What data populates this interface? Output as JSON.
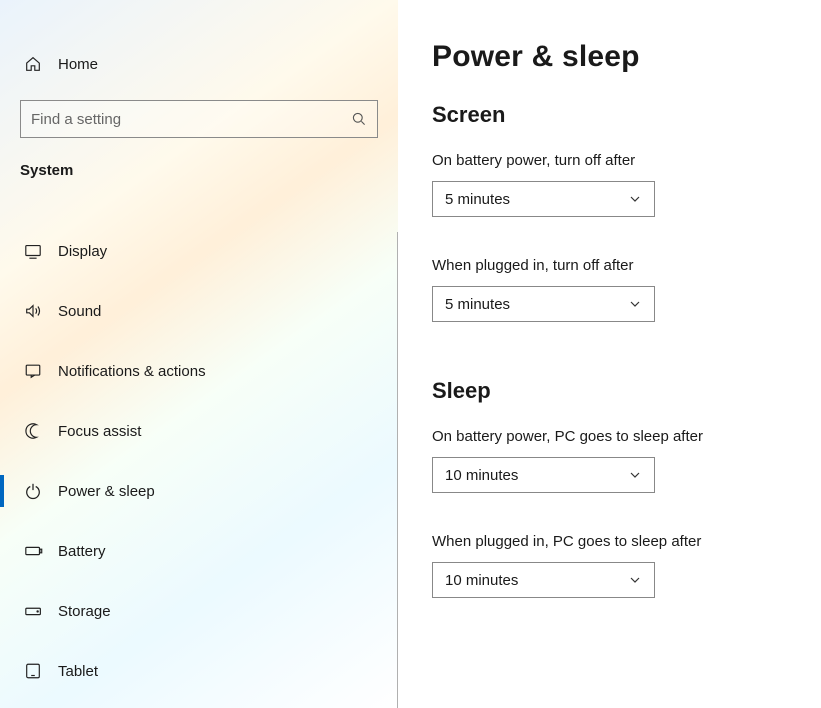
{
  "sidebar": {
    "home_label": "Home",
    "search_placeholder": "Find a setting",
    "category_label": "System",
    "items": [
      {
        "label": "Display",
        "icon": "display-icon"
      },
      {
        "label": "Sound",
        "icon": "sound-icon"
      },
      {
        "label": "Notifications & actions",
        "icon": "notifications-icon"
      },
      {
        "label": "Focus assist",
        "icon": "focus-icon"
      },
      {
        "label": "Power & sleep",
        "icon": "power-icon",
        "active": true
      },
      {
        "label": "Battery",
        "icon": "battery-icon"
      },
      {
        "label": "Storage",
        "icon": "storage-icon"
      },
      {
        "label": "Tablet",
        "icon": "tablet-icon"
      }
    ]
  },
  "main": {
    "title": "Power & sleep",
    "sections": {
      "screen": {
        "title": "Screen",
        "battery_label": "On battery power, turn off after",
        "battery_value": "5 minutes",
        "plugged_label": "When plugged in, turn off after",
        "plugged_value": "5 minutes"
      },
      "sleep": {
        "title": "Sleep",
        "battery_label": "On battery power, PC goes to sleep after",
        "battery_value": "10 minutes",
        "plugged_label": "When plugged in, PC goes to sleep after",
        "plugged_value": "10 minutes"
      }
    }
  }
}
